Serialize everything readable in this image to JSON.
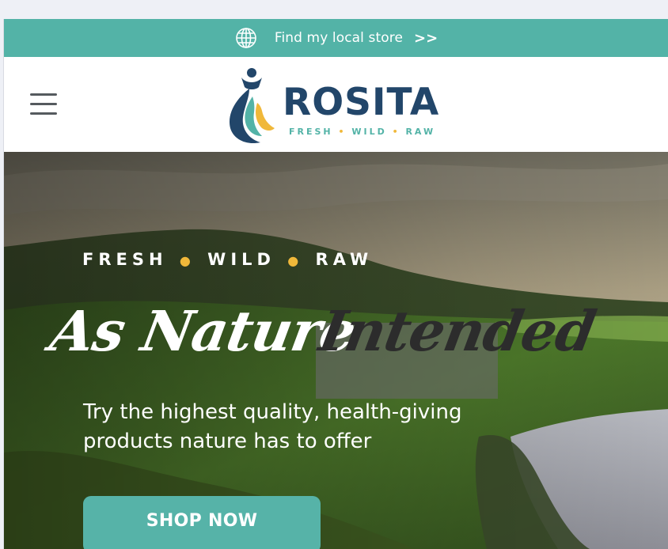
{
  "store_bar": {
    "icon": "globe-icon",
    "label": "Find my local store",
    "arrows": ">>",
    "bg_color": "#53b3a7"
  },
  "header": {
    "menu_icon": "hamburger-menu-icon",
    "logo": {
      "brand": "ROSITA",
      "tagline_words": [
        "FRESH",
        "WILD",
        "RAW"
      ],
      "brand_color": "#22466a",
      "accent_color": "#53b3a7",
      "dot_color": "#f0b83a"
    }
  },
  "hero": {
    "kicker_words": [
      "FRESH",
      "WILD",
      "RAW"
    ],
    "title_part1": "As Nature",
    "title_part2": "Intended",
    "subtitle": "Try the highest quality, health-giving products nature has to offer",
    "cta_label": "SHOP NOW",
    "cta_color": "#56b3a8"
  }
}
